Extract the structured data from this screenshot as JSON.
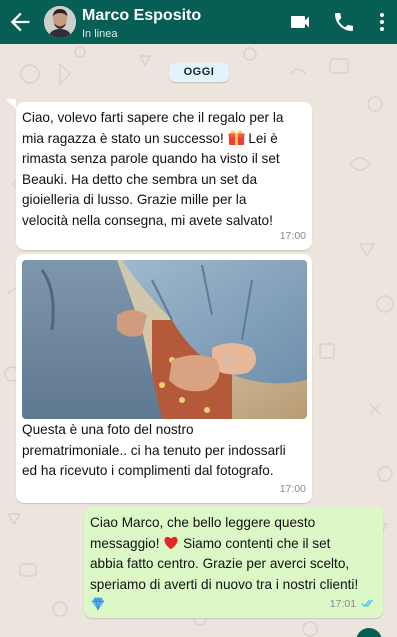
{
  "header": {
    "contact_name": "Marco Esposito",
    "status": "In linea",
    "colors": {
      "bar": "#075e54",
      "text": "#ffffff"
    },
    "icons": [
      "back-arrow-icon",
      "video-call-icon",
      "phone-icon",
      "more-vert-icon"
    ]
  },
  "chat": {
    "date_chip": "OGGI",
    "messages": [
      {
        "direction": "incoming",
        "lines": [
          "Ciao, volevo farti sapere che il regalo per la",
          "mia ragazza è stato un successo!",
          "rimasta senza parole quando ha visto il set",
          "Beauki. Ha detto che sembra un set da",
          "gioielleria di lusso. Grazie mille per la",
          "velocità nella consegna, mi avete salvato!"
        ],
        "line2_suffix": "Lei è",
        "emoji": "gift-emoji",
        "time": "17:00"
      },
      {
        "direction": "incoming",
        "image": "couple-holding-hands-photo",
        "caption_lines": [
          "Questa è una foto del nostro",
          "prematrimoniale.. ci ha tenuto per indossarli",
          "ed ha ricevuto i complimenti dal fotografo."
        ],
        "time": "17:00"
      },
      {
        "direction": "outgoing",
        "lines": [
          "Ciao Marco, che bello leggere questo",
          "messaggio!",
          "abbia fatto centro. Grazie per averci scelto,",
          "speriamo di averti di nuovo tra i nostri clienti!"
        ],
        "line2_suffix": "Siamo contenti che il set",
        "emoji_heart": "red-heart-emoji",
        "emoji_end": "gem-emoji",
        "time": "17:01",
        "read_status": "double-check-read"
      }
    ]
  },
  "colors": {
    "incoming_bubble": "#ffffff",
    "outgoing_bubble": "#dcf8c6",
    "chat_bg": "#ece5dd",
    "read_ticks": "#4fc3f7"
  }
}
